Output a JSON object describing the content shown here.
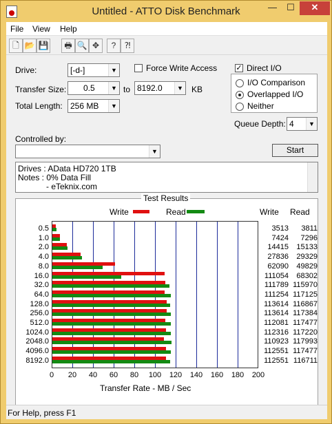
{
  "window": {
    "title": "Untitled - ATTO Disk Benchmark",
    "min": "—",
    "max": "☐",
    "close": "✕"
  },
  "menu": [
    "File",
    "View",
    "Help"
  ],
  "toolbar": [
    {
      "name": "new-icon",
      "glyph": "🗋"
    },
    {
      "name": "open-icon",
      "glyph": "📂"
    },
    {
      "name": "save-icon",
      "glyph": "💾"
    },
    {
      "name": "print-icon",
      "glyph": "🖶"
    },
    {
      "name": "print-preview-icon",
      "glyph": "🔍"
    },
    {
      "name": "move-icon",
      "glyph": "✥"
    },
    {
      "name": "help-icon",
      "glyph": "?"
    },
    {
      "name": "context-help-icon",
      "glyph": "⁈"
    }
  ],
  "form": {
    "drive_label": "Drive:",
    "drive_value": "[-d-]",
    "force_write_label": "Force Write Access",
    "direct_io_label": "Direct I/O",
    "transfer_size_label": "Transfer Size:",
    "transfer_from": "0.5",
    "to_label": "to",
    "transfer_to": "8192.0",
    "kb_label": "KB",
    "io_comparison_label": "I/O Comparison",
    "overlapped_label": "Overlapped I/O",
    "neither_label": "Neither",
    "total_length_label": "Total Length:",
    "total_length_value": "256 MB",
    "queue_depth_label": "Queue Depth:",
    "queue_depth_value": "4",
    "controlled_by_label": "Controlled by:",
    "controlled_by_value": "",
    "start_label": "Start"
  },
  "notes": {
    "line1": "Drives :  AData HD720 1TB",
    "line2": "Notes :   0% Data Fill",
    "line3": "- eTeknix.com"
  },
  "results": {
    "title": "Test Results",
    "write_label": "Write",
    "read_label": "Read",
    "col_write": "Write",
    "col_read": "Read",
    "x_label": "Transfer Rate - MB / Sec"
  },
  "colors": {
    "write": "#e01010",
    "read": "#138a13",
    "grid": "#1b2a9a",
    "titlebar": "#f0cc6e"
  },
  "chart_data": {
    "type": "bar",
    "categories": [
      "0.5",
      "1.0",
      "2.0",
      "4.0",
      "8.0",
      "16.0",
      "32.0",
      "64.0",
      "128.0",
      "256.0",
      "512.0",
      "1024.0",
      "2048.0",
      "4096.0",
      "8192.0"
    ],
    "series": [
      {
        "name": "Write",
        "values": [
          3513,
          7424,
          14415,
          27836,
          62090,
          111054,
          111789,
          111254,
          113614,
          113614,
          112081,
          112316,
          110923,
          112551,
          112551
        ]
      },
      {
        "name": "Read",
        "values": [
          3811,
          7296,
          15133,
          29329,
          49829,
          68302,
          115970,
          117125,
          116867,
          117384,
          117477,
          117220,
          117993,
          117477,
          116711
        ]
      }
    ],
    "x_ticks": [
      "0",
      "20",
      "40",
      "60",
      "80",
      "100",
      "120",
      "140",
      "160",
      "180",
      "200"
    ],
    "xlim": [
      0,
      200
    ],
    "xlabel": "Transfer Rate - MB / Sec",
    "unit_values": "KB/s"
  },
  "status": "For Help, press F1"
}
